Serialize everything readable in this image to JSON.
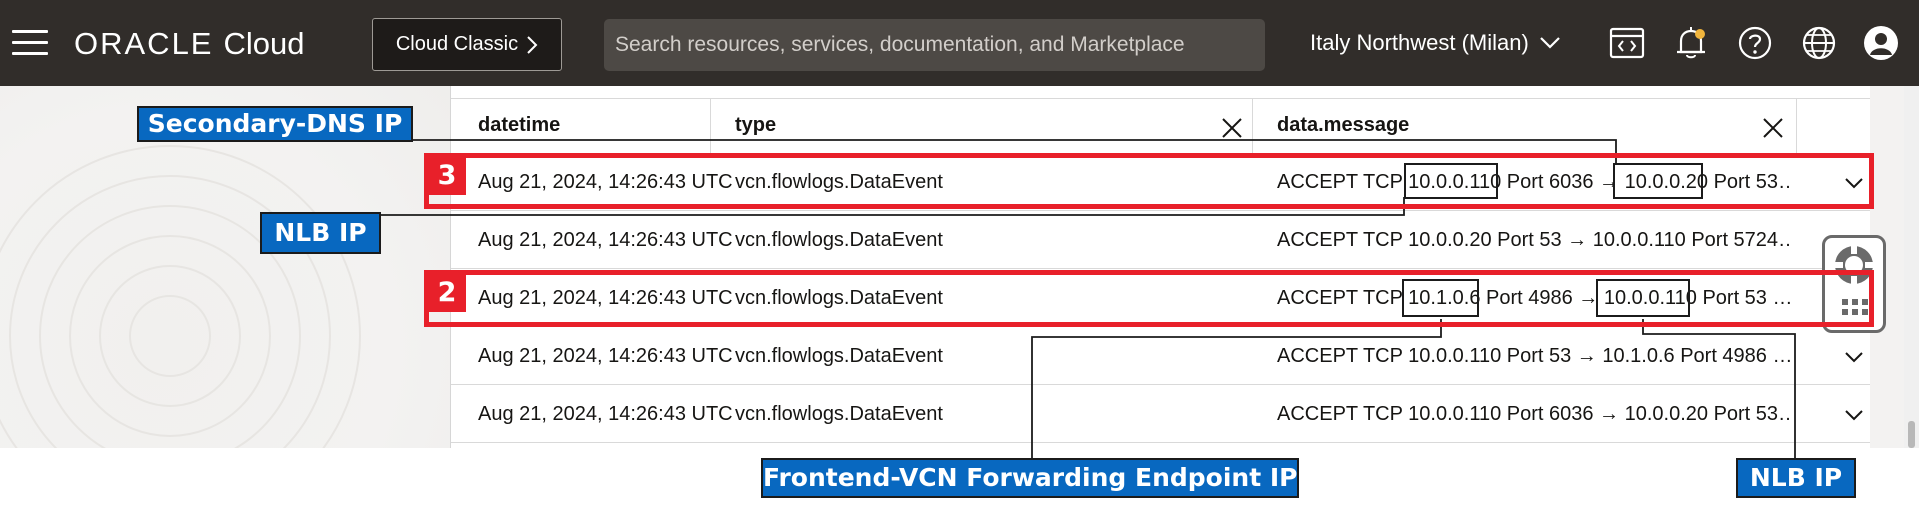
{
  "topbar": {
    "brand_oracle": "ORACLE",
    "brand_cloud": "Cloud",
    "classic_button": "Cloud Classic",
    "search_placeholder": "Search resources, services, documentation, and Marketplace",
    "region": "Italy Northwest (Milan)",
    "icons": [
      "menu-icon",
      "code-editor-icon",
      "bell-icon",
      "help-icon",
      "globe-icon",
      "user-avatar-icon"
    ],
    "notification_dot_color": "#f0b43c"
  },
  "table": {
    "columns": [
      "datetime",
      "type",
      "data.message"
    ],
    "rows": [
      {
        "datetime": "Aug 21, 2024, 14:26:43 UTC",
        "type": "vcn.flowlogs.DataEvent",
        "message": "ACCEPT TCP 10.0.0.110 Port 6036 → 10.0.0.20 Port 53…"
      },
      {
        "datetime": "Aug 21, 2024, 14:26:43 UTC",
        "type": "vcn.flowlogs.DataEvent",
        "message": "ACCEPT TCP 10.0.0.20 Port 53 → 10.0.0.110 Port 5724…"
      },
      {
        "datetime": "Aug 21, 2024, 14:26:43 UTC",
        "type": "vcn.flowlogs.DataEvent",
        "message": "ACCEPT TCP 10.1.0.6 Port 4986 → 10.0.0.110 Port 53 …"
      },
      {
        "datetime": "Aug 21, 2024, 14:26:43 UTC",
        "type": "vcn.flowlogs.DataEvent",
        "message": "ACCEPT TCP 10.0.0.110 Port 53 → 10.1.0.6 Port 4986 …"
      },
      {
        "datetime": "Aug 21, 2024, 14:26:43 UTC",
        "type": "vcn.flowlogs.DataEvent",
        "message": "ACCEPT TCP 10.0.0.110 Port 6036 → 10.0.0.20 Port 53…"
      }
    ]
  },
  "annotations": {
    "secondary_dns": "Secondary-DNS IP",
    "nlb_ip_left": "NLB IP",
    "frontend_vcn": "Frontend-VCN Forwarding Endpoint IP",
    "nlb_ip_bottom": "NLB IP",
    "badge_3": "3",
    "badge_2": "2",
    "highlight_color": "#e8202a",
    "label_color": "#0868c0"
  }
}
